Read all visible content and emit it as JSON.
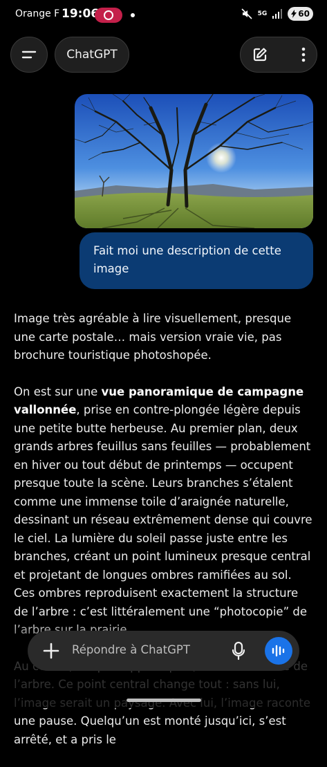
{
  "status_bar": {
    "carrier": "Orange F",
    "time": "19:06",
    "battery": "60",
    "network": "5G"
  },
  "header": {
    "title": "ChatGPT"
  },
  "conversation": {
    "user_message": "Fait moi une description de cette image",
    "assistant": {
      "p1": "Image très agréable à lire visuellement, presque une carte postale… mais version vraie vie, pas brochure touristique photoshopée.",
      "p2_before": "On est sur une ",
      "p2_bold": "vue panoramique de campagne vallonnée",
      "p2_after": ", prise en contre-plongée légère depuis une petite butte herbeuse. Au premier plan, deux grands arbres feuillus sans feuilles — probablement en hiver ou tout début de printemps — occupent presque toute la scène. Leurs branches s’étalent comme une immense toile d’araignée naturelle, dessinant un réseau extrêmement dense qui couvre le ciel. La lumière du soleil passe juste entre les branches, créant un point lumineux presque central et projetant de longues ombres ramifiées au sol. Ces ombres reproduisent exactement la structure de l’arbre : c’est littéralement une “photocopie” de l’arbre sur la prairie.",
      "p3": "Au centre, ce qui frappe le plus, c’est la solitude de l’arbre. Ce point central change tout : sans lui, l’image serait un paysage. Avec lui, l’image raconte une pause. Quelqu’un est monté jusqu’ici, s’est arrêté, et a pris le"
    }
  },
  "composer": {
    "placeholder": "Répondre à ChatGPT"
  },
  "colors": {
    "user_bubble": "#0b3b73",
    "voice_button": "#1a73e8",
    "app_pill": "#c4204a"
  }
}
